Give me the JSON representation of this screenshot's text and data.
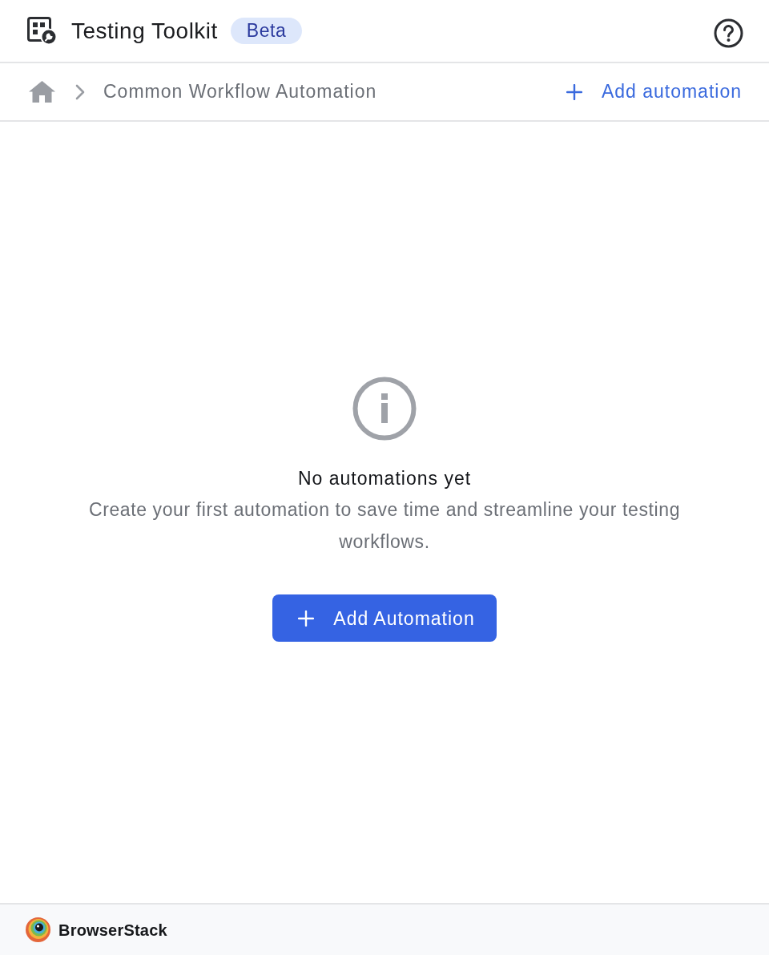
{
  "header": {
    "title": "Testing Toolkit",
    "badge": "Beta"
  },
  "breadcrumb": {
    "current": "Common Workflow Automation",
    "action": "Add automation"
  },
  "empty_state": {
    "title": "No automations yet",
    "description": "Create your first automation to save time and streamline your testing workflows.",
    "button": "Add Automation"
  },
  "footer": {
    "brand": "BrowserStack"
  }
}
